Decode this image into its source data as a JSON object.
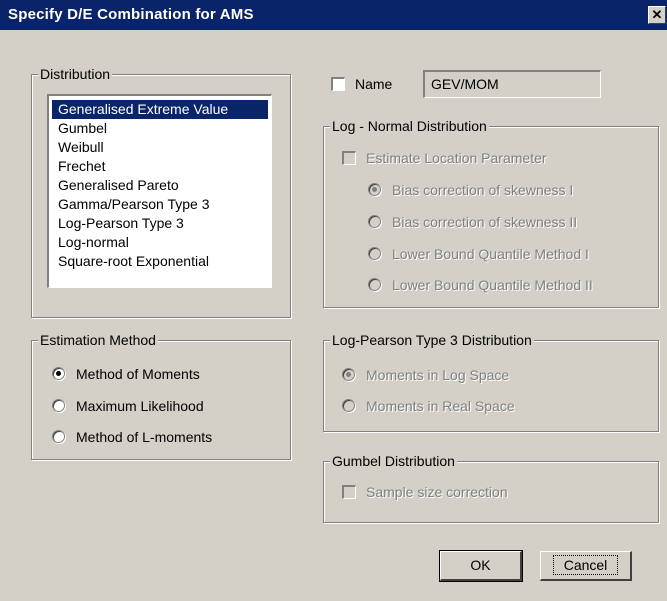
{
  "window": {
    "title": "Specify D/E Combination for AMS",
    "close_glyph": "✕"
  },
  "distribution": {
    "legend": "Distribution",
    "items": [
      "Generalised Extreme Value",
      "Gumbel",
      "Weibull",
      "Frechet",
      "Generalised Pareto",
      "Gamma/Pearson Type 3",
      "Log-Pearson Type 3",
      "Log-normal",
      "Square-root Exponential"
    ],
    "selected_index": 0
  },
  "estimation": {
    "legend": "Estimation Method",
    "options": [
      "Method of Moments",
      "Maximum Likelihood",
      "Method of L-moments"
    ],
    "selected_index": 0
  },
  "name": {
    "label": "Name",
    "checked": false,
    "value": "GEV/MOM"
  },
  "lognormal": {
    "legend": "Log - Normal Distribution",
    "estimate_label": "Estimate Location Parameter",
    "options": [
      "Bias correction of skewness I",
      "Bias correction of skewness II",
      "Lower Bound Quantile Method I",
      "Lower Bound Quantile Method II"
    ],
    "selected_index": 0,
    "enabled": false
  },
  "logpearson": {
    "legend": "Log-Pearson Type 3 Distribution",
    "options": [
      "Moments in Log Space",
      "Moments in Real Space"
    ],
    "selected_index": 0,
    "enabled": false
  },
  "gumbel": {
    "legend": "Gumbel Distribution",
    "sample_size_label": "Sample size correction",
    "enabled": false
  },
  "buttons": {
    "ok": "OK",
    "cancel": "Cancel"
  }
}
